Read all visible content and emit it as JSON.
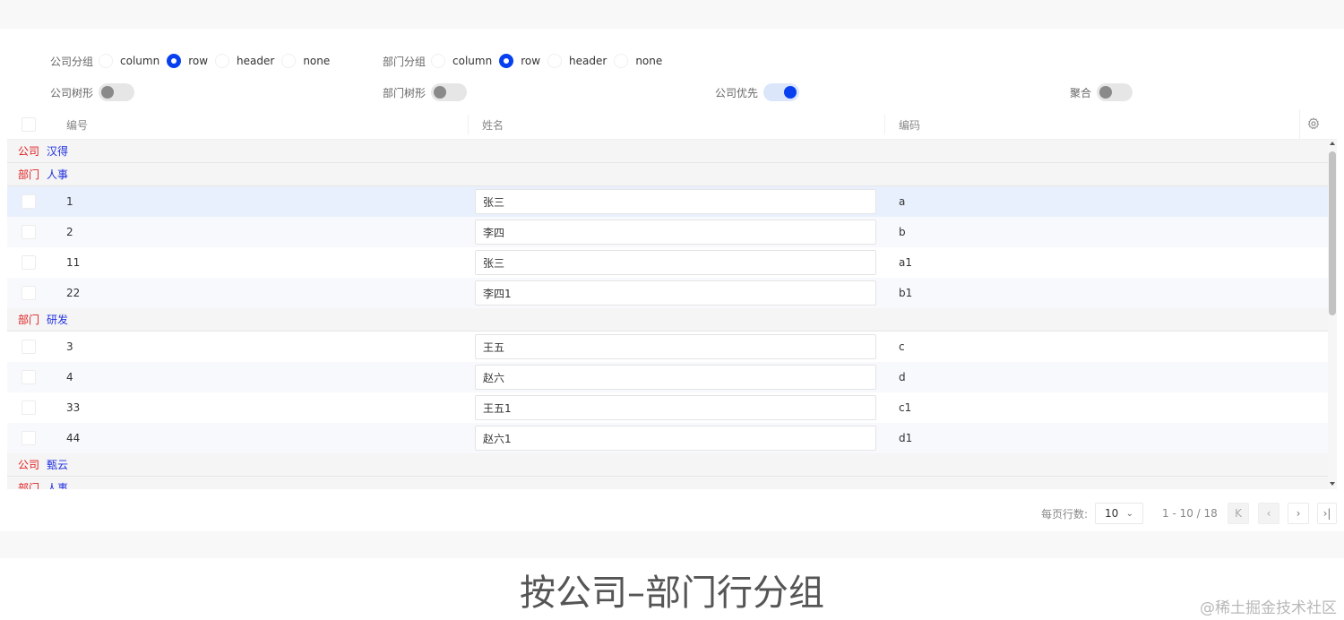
{
  "controls": {
    "company_group": {
      "label": "公司分组",
      "options": [
        "column",
        "row",
        "header",
        "none"
      ],
      "selected": "row"
    },
    "department_group": {
      "label": "部门分组",
      "options": [
        "column",
        "row",
        "header",
        "none"
      ],
      "selected": "row"
    },
    "company_tree": {
      "label": "公司树形",
      "on": false
    },
    "department_tree": {
      "label": "部门树形",
      "on": false
    },
    "company_first": {
      "label": "公司优先",
      "on": true
    },
    "aggregate": {
      "label": "聚合",
      "on": false
    }
  },
  "table": {
    "columns": [
      "编号",
      "姓名",
      "编码"
    ],
    "settings_icon": "gear-icon",
    "group_colors": {
      "key": "#e02020",
      "value": "#2030e0"
    },
    "rows": [
      {
        "kind": "group",
        "key": "公司",
        "value": "汉得"
      },
      {
        "kind": "group",
        "key": "部门",
        "value": "人事"
      },
      {
        "kind": "data",
        "id": "1",
        "name": "张三",
        "code": "a",
        "selected": true
      },
      {
        "kind": "data",
        "id": "2",
        "name": "李四",
        "code": "b"
      },
      {
        "kind": "data",
        "id": "11",
        "name": "张三",
        "code": "a1"
      },
      {
        "kind": "data",
        "id": "22",
        "name": "李四1",
        "code": "b1"
      },
      {
        "kind": "group",
        "key": "部门",
        "value": "研发"
      },
      {
        "kind": "data",
        "id": "3",
        "name": "王五",
        "code": "c"
      },
      {
        "kind": "data",
        "id": "4",
        "name": "赵六",
        "code": "d"
      },
      {
        "kind": "data",
        "id": "33",
        "name": "王五1",
        "code": "c1"
      },
      {
        "kind": "data",
        "id": "44",
        "name": "赵六1",
        "code": "d1"
      },
      {
        "kind": "group",
        "key": "公司",
        "value": "甄云"
      },
      {
        "kind": "group",
        "key": "部门",
        "value": "人事"
      }
    ]
  },
  "pagination": {
    "page_size_label": "每页行数:",
    "page_size": "10",
    "range": "1 - 10 / 18",
    "buttons": [
      "first-page-icon",
      "prev-page-icon",
      "next-page-icon",
      "last-page-icon"
    ]
  },
  "caption": "按公司–部门行分组",
  "watermark": "@稀土掘金技术社区",
  "accent_color": "#0840f0"
}
